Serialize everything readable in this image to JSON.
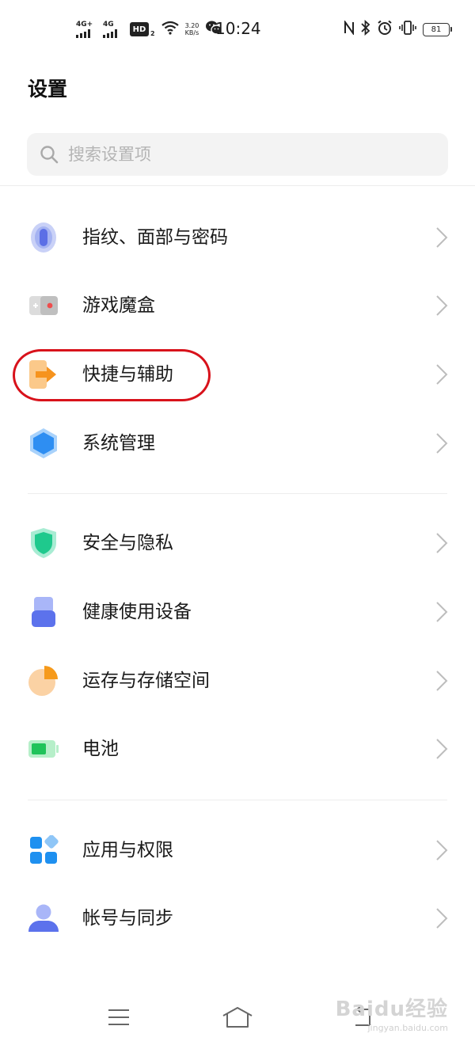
{
  "status_bar": {
    "signal1_label": "4G+",
    "signal2_label": "4G",
    "hd_label": "HD",
    "hd_sub": "2",
    "speed_value": "3.20",
    "speed_unit": "KB/s",
    "time": "10:24",
    "battery_level": "81"
  },
  "header": {
    "title": "设置"
  },
  "search": {
    "placeholder": "搜索设置项"
  },
  "groups": [
    {
      "items": [
        {
          "label": "指纹、面部与密码",
          "icon": "fingerprint-icon"
        },
        {
          "label": "游戏魔盒",
          "icon": "game-box-icon"
        },
        {
          "label": "快捷与辅助",
          "icon": "shortcut-icon"
        },
        {
          "label": "系统管理",
          "icon": "system-hexagon-icon"
        }
      ]
    },
    {
      "items": [
        {
          "label": "安全与隐私",
          "icon": "shield-icon"
        },
        {
          "label": "健康使用设备",
          "icon": "health-device-icon"
        },
        {
          "label": "运存与存储空间",
          "icon": "storage-pie-icon"
        },
        {
          "label": "电池",
          "icon": "battery-icon"
        }
      ]
    },
    {
      "items": [
        {
          "label": "应用与权限",
          "icon": "apps-grid-icon"
        },
        {
          "label": "帐号与同步",
          "icon": "account-icon"
        }
      ]
    }
  ],
  "watermark": {
    "text": "Baidu经验",
    "sub": "jingyan.baidu.com"
  },
  "colors": {
    "highlight": "#d8121b",
    "chevron": "#bdbdbd"
  }
}
